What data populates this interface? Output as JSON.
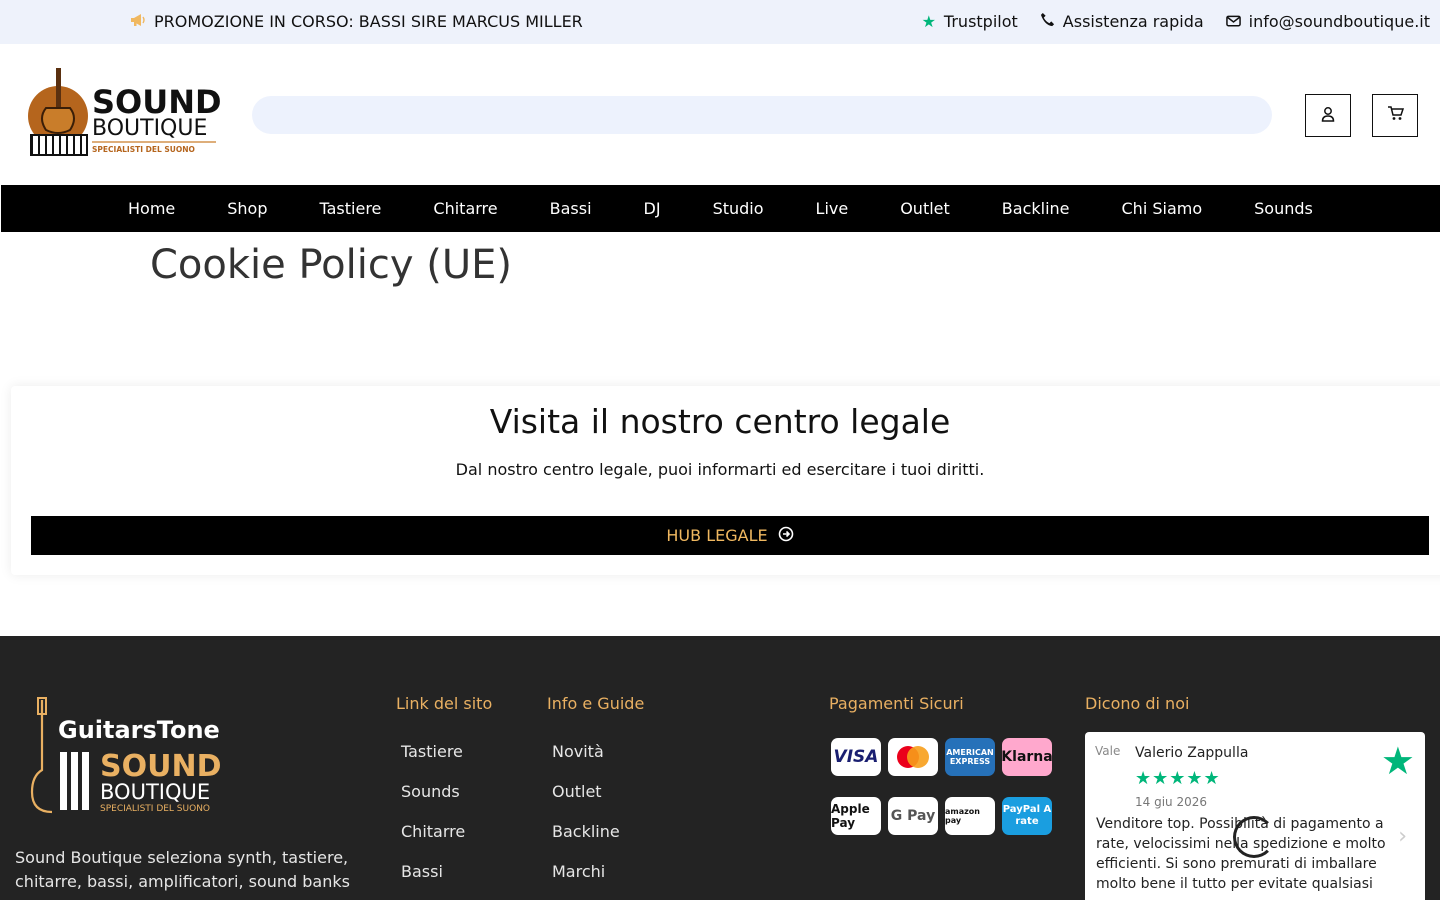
{
  "topbar": {
    "promo": "PROMOZIONE IN CORSO: BASSI SIRE MARCUS MILLER",
    "trustpilot": "Trustpilot",
    "support": "Assistenza rapida",
    "email": "info@soundboutique.it"
  },
  "header": {
    "logo_text": {
      "line1": "SOUND",
      "line2": "BOUTIQUE",
      "tagline": "SPECIALISTI DEL SUONO"
    },
    "search_placeholder": ""
  },
  "nav": {
    "items": [
      "Home",
      "Shop",
      "Tastiere",
      "Chitarre",
      "Bassi",
      "DJ",
      "Studio",
      "Live",
      "Outlet",
      "Backline",
      "Chi Siamo",
      "Sounds"
    ]
  },
  "page": {
    "title": "Cookie Policy (UE)"
  },
  "legal": {
    "heading": "Visita il nostro centro legale",
    "text": "Dal nostro centro legale, puoi informarti ed esercitare i tuoi diritti.",
    "button": "HUB LEGALE"
  },
  "footer": {
    "logo_text": {
      "brand1": "GuitarsTone",
      "line1": "SOUND",
      "line2": "BOUTIQUE",
      "tagline": "SPECIALISTI DEL SUONO"
    },
    "description": "Sound Boutique seleziona synth, tastiere, chitarre, bassi, amplificatori, sound banks",
    "col1": {
      "title": "Link del sito",
      "links": [
        "Tastiere",
        "Sounds",
        "Chitarre",
        "Bassi"
      ]
    },
    "col2": {
      "title": "Info e Guide",
      "links": [
        "Novità",
        "Outlet",
        "Backline",
        "Marchi"
      ]
    },
    "payments": {
      "title": "Pagamenti Sicuri",
      "methods": [
        "VISA",
        "Mastercard",
        "AMERICAN EXPRESS",
        "Klarna",
        "Apple Pay",
        "G Pay",
        "amazon pay",
        "PayPal A rate"
      ]
    },
    "reviews": {
      "title": "Dicono di noi",
      "avatar_alt": "Vale",
      "name": "Valerio Zappulla",
      "stars": "★★★★★",
      "date": "14 giu 2026",
      "text": "Venditore top. Possibilità di pagamento a rate, velocissimi nella spedizione e molto efficienti. Si sono premurati di imballare molto bene il tutto per evitate qualsiasi"
    }
  },
  "colors": {
    "accent": "#e9b062",
    "nav_bg": "#000000",
    "footer_bg": "#232323",
    "trustpilot": "#00b67a"
  }
}
